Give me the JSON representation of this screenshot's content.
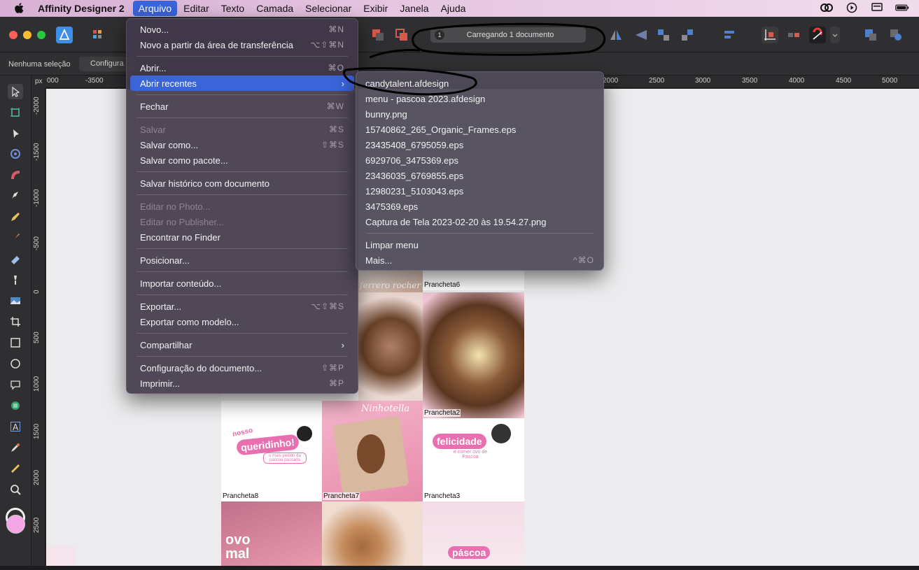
{
  "menubar": {
    "app_name": "Affinity Designer 2",
    "items": [
      "Arquivo",
      "Editar",
      "Texto",
      "Camada",
      "Selecionar",
      "Exibir",
      "Janela",
      "Ajuda"
    ],
    "active": "Arquivo",
    "status_icons": [
      "creative-cloud-icon",
      "play-circle-icon",
      "display-icon",
      "battery-icon"
    ]
  },
  "toolbar": {
    "loading_count": "1",
    "loading_text": "Carregando 1 documento"
  },
  "context_bar": {
    "no_selection": "Nenhuma seleção",
    "config_button": "Configura"
  },
  "ruler": {
    "unit": "px",
    "top_ticks": [
      "000",
      "-3500",
      "2000",
      "2500",
      "3000",
      "3500",
      "4000",
      "4500",
      "5000"
    ],
    "left_ticks": [
      "-2000",
      "-1500",
      "-1000",
      "-500",
      "0",
      "500",
      "1000",
      "1500",
      "2000",
      "2500"
    ]
  },
  "file_menu": {
    "groups": [
      [
        {
          "label": "Novo...",
          "shortcut": "⌘N"
        },
        {
          "label": "Novo a partir da área de transferência",
          "shortcut": "⌥⇧⌘N"
        }
      ],
      [
        {
          "label": "Abrir...",
          "shortcut": "⌘O"
        },
        {
          "label": "Abrir recentes",
          "submenu": true
        }
      ],
      [
        {
          "label": "Fechar",
          "shortcut": "⌘W"
        }
      ],
      [
        {
          "label": "Salvar",
          "shortcut": "⌘S",
          "disabled": true
        },
        {
          "label": "Salvar como...",
          "shortcut": "⇧⌘S"
        },
        {
          "label": "Salvar como pacote..."
        }
      ],
      [
        {
          "label": "Salvar histórico com documento"
        }
      ],
      [
        {
          "label": "Editar no Photo...",
          "disabled": true
        },
        {
          "label": "Editar no Publisher...",
          "disabled": true
        },
        {
          "label": "Encontrar no Finder"
        }
      ],
      [
        {
          "label": "Posicionar..."
        }
      ],
      [
        {
          "label": "Importar conteúdo..."
        }
      ],
      [
        {
          "label": "Exportar...",
          "shortcut": "⌥⇧⌘S"
        },
        {
          "label": "Exportar como modelo..."
        }
      ],
      [
        {
          "label": "Compartilhar",
          "submenu": true
        }
      ],
      [
        {
          "label": "Configuração do documento...",
          "shortcut": "⇧⌘P"
        },
        {
          "label": "Imprimir...",
          "shortcut": "⌘P"
        }
      ]
    ]
  },
  "recent_menu": {
    "files": [
      "candytalent.afdesign",
      "menu - pascoa 2023.afdesign",
      "bunny.png",
      "15740862_265_Organic_Frames.eps",
      "23435408_6795059.eps",
      "6929706_3475369.eps",
      "23436035_6769855.eps",
      "12980231_5103043.eps",
      "3475369.eps",
      "Captura de Tela 2023-02-20 às 19.54.27.png"
    ],
    "clear": "Limpar menu",
    "more": "Mais...",
    "more_shortcut": "^⌘O"
  },
  "artboards": {
    "labels": [
      "Prancheta6",
      "Prancheta2",
      "Prancheta8",
      "Prancheta7",
      "Prancheta3"
    ],
    "texts": {
      "script_top": "ferrero rocher",
      "nosso": "nosso",
      "queridinho": "queridinho!",
      "queridinho_sub": "o mais pedido da páscoa passada",
      "nutella": "Ninhotella",
      "felicidade": "felicidade",
      "felicidade_sub": "é comer ovo de Páscoa",
      "ovo": "ovo",
      "mal": "mal",
      "pascoa": "páscoa"
    }
  },
  "colors": {
    "accent": "#3a64d8",
    "fill_swatch": "#f4a6e6",
    "annotation": "#000000"
  }
}
